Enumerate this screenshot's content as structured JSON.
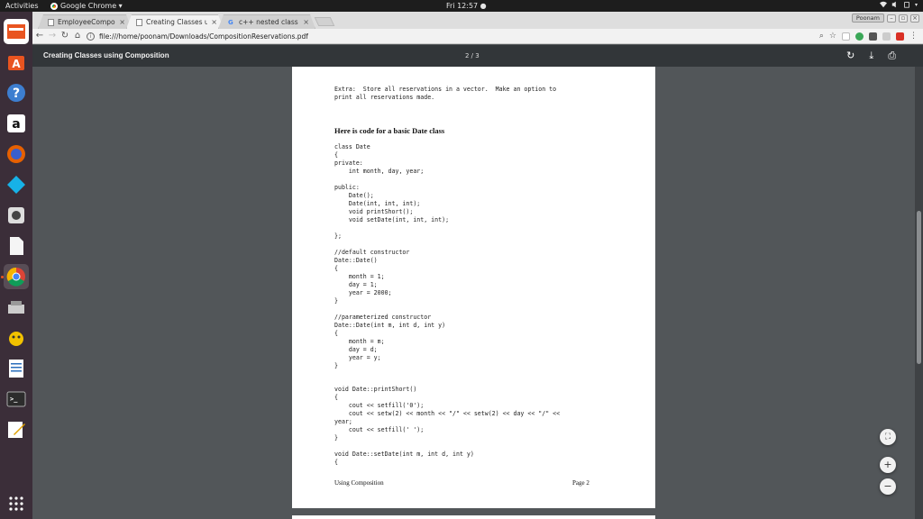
{
  "topbar": {
    "activities": "Activities",
    "app_name": "Google Chrome ▾",
    "clock": "Fri 12:57 ●",
    "system_icons": [
      "wifi-icon",
      "volume-icon",
      "power-icon"
    ]
  },
  "dock": {
    "items": [
      "ubuntu-software-icon",
      "help-icon",
      "amazon-icon",
      "firefox-icon",
      "kodi-icon",
      "webcam-icon",
      "files-icon",
      "chrome-icon",
      "scanner-icon",
      "trash-icon",
      "libreoffice-writer-icon",
      "terminal-icon",
      "text-editor-icon",
      "app-grid-icon"
    ]
  },
  "browser": {
    "tabs": [
      {
        "label": "EmployeeComposit",
        "close": "×"
      },
      {
        "label": "Creating Classes us",
        "close": "×"
      },
      {
        "label": "c++ nested class acc",
        "close": "×"
      }
    ],
    "profile": "Poonam",
    "url": "file:///home/poonam/Downloads/CompositionReservations.pdf"
  },
  "pdf": {
    "title": "Creating Classes using Composition",
    "page_indicator": "2 / 3",
    "content": {
      "extra_line1": "Extra:  Store all reservations in a vector.  Make an option to",
      "extra_line2": "print all reservations made.",
      "heading": "Here is code for a basic Date class",
      "code1": "class Date\n{\nprivate:\n    int month, day, year;",
      "code2": "public:\n    Date();\n    Date(int, int, int);\n    void printShort();\n    void setDate(int, int, int);",
      "code3": "};",
      "code4": "//default constructor\nDate::Date()\n{\n    month = 1;\n    day = 1;\n    year = 2000;\n}",
      "code5": "//parameterized constructor\nDate::Date(int m, int d, int y)\n{\n    month = m;\n    day = d;\n    year = y;\n}",
      "code6": "void Date::printShort()\n{\n    cout << setfill('0');\n    cout << setw(2) << month << \"/\" << setw(2) << day << \"/\" <<\nyear;\n    cout << setfill(' ');\n}",
      "code7": "void Date::setDate(int m, int d, int y)\n{",
      "footer_left": "Using Composition",
      "footer_right": "Page 2"
    }
  }
}
